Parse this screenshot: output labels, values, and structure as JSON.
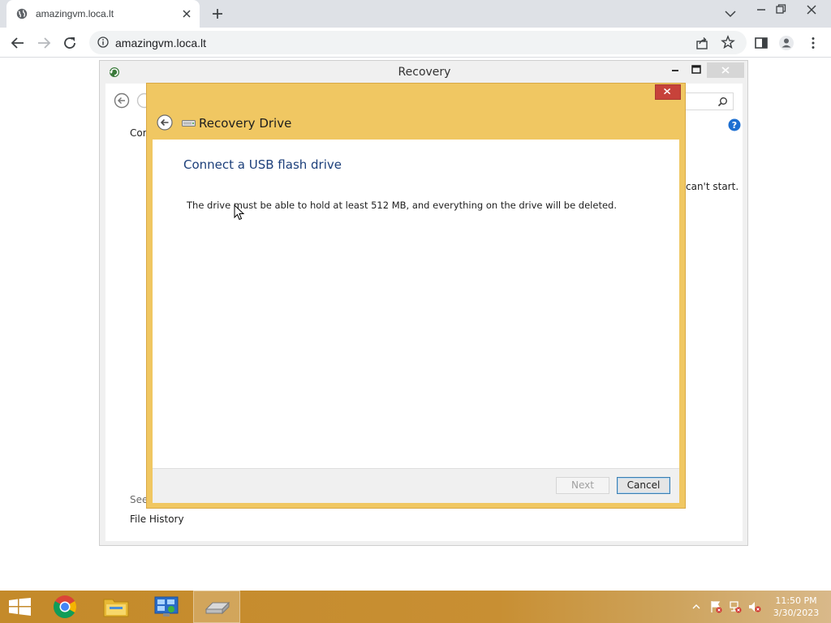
{
  "browser": {
    "tab_title": "amazingvm.loca.lt",
    "url": "amazingvm.loca.lt"
  },
  "recovery_window": {
    "title": "Recovery",
    "partial_text_left": "Con",
    "partial_text_right": "can't start.",
    "see_also_label": "See",
    "file_history_link": "File History"
  },
  "dialog": {
    "title": "Recovery Drive",
    "heading": "Connect a USB flash drive",
    "message": "The drive must be able to hold at least 512 MB, and everything on the drive will be deleted.",
    "next_label": "Next",
    "cancel_label": "Cancel"
  },
  "taskbar": {
    "time": "11:50 PM",
    "date": "3/30/2023"
  },
  "colors": {
    "dialog_accent": "#f0c762",
    "heading_blue": "#1c3f7a",
    "taskbar": "#c88f33"
  }
}
